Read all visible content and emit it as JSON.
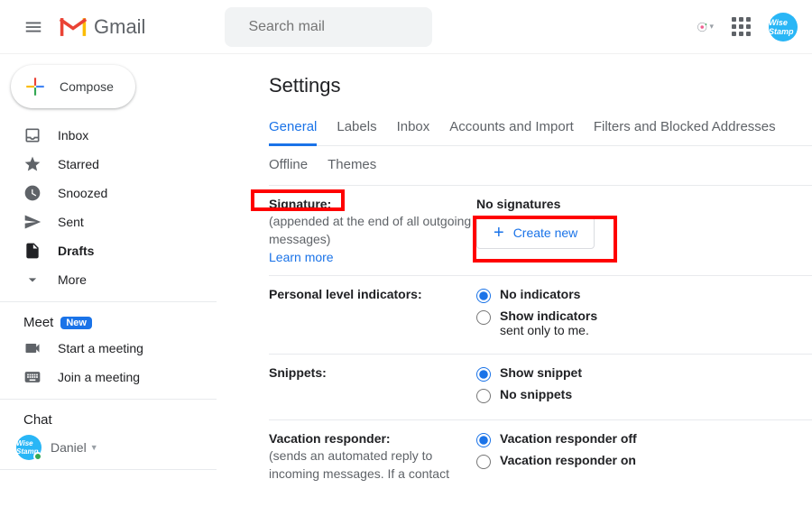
{
  "header": {
    "product_name": "Gmail",
    "search_placeholder": "Search mail",
    "avatar_text": "Wise Stamp"
  },
  "sidebar": {
    "compose_label": "Compose",
    "items": [
      {
        "label": "Inbox"
      },
      {
        "label": "Starred"
      },
      {
        "label": "Snoozed"
      },
      {
        "label": "Sent"
      },
      {
        "label": "Drafts"
      },
      {
        "label": "More"
      }
    ],
    "meet": {
      "title": "Meet",
      "badge": "New",
      "start": "Start a meeting",
      "join": "Join a meeting"
    },
    "chat": {
      "title": "Chat",
      "user": "Daniel",
      "avatar_text": "Wise Stamp"
    }
  },
  "main": {
    "title": "Settings",
    "tabs_row1": [
      "General",
      "Labels",
      "Inbox",
      "Accounts and Import",
      "Filters and Blocked Addresses"
    ],
    "active_tab": 0,
    "tabs_row2": [
      "Offline",
      "Themes"
    ],
    "signature": {
      "label": "Signature:",
      "sub": "(appended at the end of all outgoing messages)",
      "learn_more": "Learn more",
      "no_sig": "No signatures",
      "create_new": "Create new"
    },
    "personal_indicators": {
      "label": "Personal level indicators:",
      "opt1": "No indicators",
      "opt2": "Show indicators",
      "opt2_sub": "sent only to me."
    },
    "snippets": {
      "label": "Snippets:",
      "opt1": "Show snippet",
      "opt2": "No snippets"
    },
    "vacation": {
      "label": "Vacation responder:",
      "sub": "(sends an automated reply to incoming messages. If a contact",
      "opt1": "Vacation responder off",
      "opt2": "Vacation responder on"
    }
  }
}
